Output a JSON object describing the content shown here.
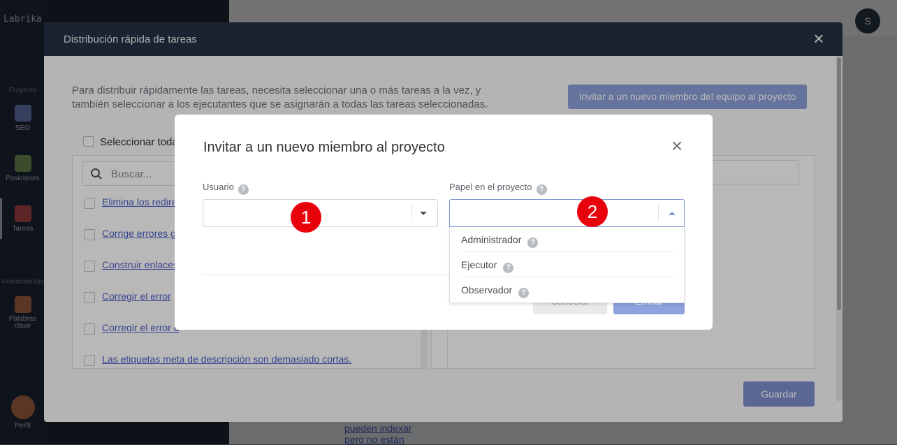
{
  "app": {
    "brand": "Labrika",
    "sections": {
      "project": "Proyecto",
      "tools": "Herramientas"
    },
    "nav": [
      {
        "label": "SEO",
        "color": "#7b8fd0"
      },
      {
        "label": "Posiciones",
        "color": "#86a865"
      },
      {
        "label": "Tareas",
        "color": "#d3565e"
      },
      {
        "label": "Palabras clave",
        "color": "#cf7b54"
      },
      {
        "label": "Perfil",
        "color": "#cf7b54"
      }
    ],
    "avatar_initial": "S",
    "background_text": "pueden indexar pero no están"
  },
  "big_modal": {
    "title": "Distribución rápida de tareas",
    "description": "Para distribuir rápidamente las tareas, necesita seleccionar una o más tareas a la vez, y también seleccionar a los ejecutantes que se asignarán a todas las tareas seleccionadas.",
    "invite_button": "Invitar a un nuevo miembro del equipo al proyecto",
    "select_all": "Seleccionar toda",
    "search_placeholder": "Buscar...",
    "tasks": [
      "Elimina los redire",
      "Corrige errores g",
      "Construir enlaces",
      "Corregir el error",
      "Corregir el error d",
      "Las etiquetas meta de descripción son demasiado cortas."
    ],
    "save_button": "Guardar"
  },
  "invite_modal": {
    "title": "Invitar a un nuevo miembro al proyecto",
    "user_label": "Usuario",
    "role_label": "Papel en el proyecto",
    "help_glyph": "?",
    "cancel_button": "Cancelar",
    "send_button": "Enviar",
    "role_options": [
      "Administrador",
      "Ejecutor",
      "Observador"
    ]
  },
  "markers": [
    "1",
    "2"
  ],
  "colors": {
    "accent": "#8ea2de",
    "header": "#253142",
    "marker": "#e8000b",
    "link": "#4c5ec6"
  }
}
